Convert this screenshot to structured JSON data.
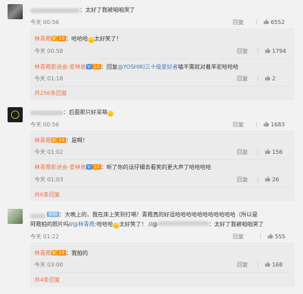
{
  "comments": [
    {
      "text": "：太好了我被咱咱哭了",
      "time": "今天 00:56",
      "reply_label": "回复",
      "likes": "6552",
      "replies": [
        {
          "name": "林青霞",
          "text": "：哈哈哈",
          "text2": "太好笑了！",
          "time": "今天 00:58",
          "reply_label": "回复",
          "likes": "1794"
        },
        {
          "name": "林青霞影迷会-爱林泉",
          "text": "：回复",
          "mention": "@YOSHIKI三十级爱好者",
          "text2": "嗑不需就对着羊驼哈哈哈",
          "time": "今天 01:18",
          "reply_label": "回复",
          "likes": "2"
        }
      ],
      "more": "共256条回复"
    },
    {
      "text": "：后面那只好呆萌",
      "time": "今天 00:56",
      "reply_label": "回复",
      "likes": "1683",
      "replies": [
        {
          "name": "林青霞",
          "text": "：是啊！",
          "time": "今天 01:02",
          "reply_label": "回复",
          "likes": "156"
        },
        {
          "name": "林青霞影迷会-爱林泉",
          "text": "：听了你的话仔细去看笑的更大声了哈哈哈哈",
          "time": "今天 01:03",
          "reply_label": "回复",
          "likes": "26"
        }
      ],
      "more": "共6条回复"
    },
    {
      "tag": "铁粉",
      "text": "：大晚上的，我在床上笑到打嗝！青霞真的好逗哈哈哈哈哈哈哈哈哈哈哈（所以是",
      "text_line2": "阿霞拍的照片吗//",
      "mention1": "@林青霞",
      "text_line2b": ":哈哈哈",
      "text_line2c": "太好笑了！ //@",
      "text_line2d": "：太好了我被咱咱哭了",
      "time": "今天 01:22",
      "reply_label": "回复",
      "likes": "555",
      "replies": [
        {
          "name": "林青霞",
          "text": "：我拍的",
          "time": "今天 03:00",
          "reply_label": "回复",
          "likes": "168"
        }
      ],
      "more": "共4条回复"
    }
  ],
  "icons": {
    "like": "thumbs-up-icon",
    "vip": "v-badge-icon",
    "level": "level-badge-icon",
    "emoji": "laughing-emoji-icon",
    "more": "more-dots-icon"
  },
  "colors": {
    "name": "#eb7350",
    "link": "#eb7350",
    "mention_blue": "#4a7ab8",
    "background": "#f2f2f2",
    "reply_bg": "#ebebeb"
  }
}
